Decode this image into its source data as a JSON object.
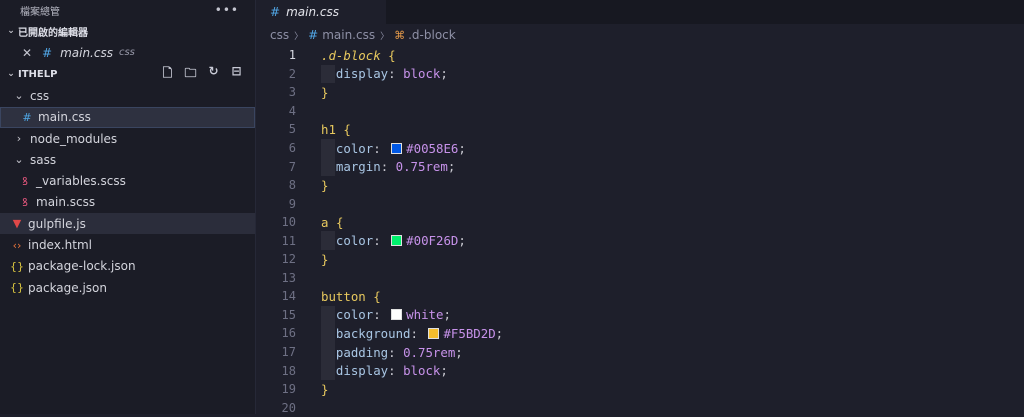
{
  "sidebar": {
    "title": "檔案總管",
    "more": "•••",
    "open_editors": {
      "header": "已開啟的編輯器",
      "items": [
        {
          "name": "main.css",
          "folder": "css"
        }
      ]
    },
    "project": {
      "header": "ITHELP",
      "tree": [
        {
          "label": "css",
          "kind": "folder"
        },
        {
          "label": "main.css",
          "kind": "css"
        },
        {
          "label": "node_modules",
          "kind": "folder-collapsed"
        },
        {
          "label": "sass",
          "kind": "folder"
        },
        {
          "label": "_variables.scss",
          "kind": "scss"
        },
        {
          "label": "main.scss",
          "kind": "scss"
        },
        {
          "label": "gulpfile.js",
          "kind": "gulp"
        },
        {
          "label": "index.html",
          "kind": "html"
        },
        {
          "label": "package-lock.json",
          "kind": "json"
        },
        {
          "label": "package.json",
          "kind": "json"
        }
      ]
    }
  },
  "editor": {
    "tab_label": "main.css",
    "breadcrumb": [
      "css",
      "main.css",
      ".d-block"
    ],
    "line_numbers": [
      "1",
      "2",
      "3",
      "4",
      "5",
      "6",
      "7",
      "8",
      "9",
      "10",
      "11",
      "12",
      "13",
      "14",
      "15",
      "16",
      "17",
      "18",
      "19",
      "20"
    ],
    "code": {
      "l1_sel": ".d-block",
      "l1_brace": "{",
      "l2_prop": "display",
      "l2_val": "block",
      "l3_brace": "}",
      "l5_sel": "h1",
      "l5_brace": "{",
      "l6_prop": "color",
      "l6_val": "#0058E6",
      "l7_prop": "margin",
      "l7_val": "0.75rem",
      "l8_brace": "}",
      "l10_sel": "a",
      "l10_brace": "{",
      "l11_prop": "color",
      "l11_val": "#00F26D",
      "l12_brace": "}",
      "l14_sel": "button",
      "l14_brace": "{",
      "l15_prop": "color",
      "l15_val": "white",
      "l16_prop": "background",
      "l16_val": "#F5BD2D",
      "l17_prop": "padding",
      "l17_val": "0.75rem",
      "l18_prop": "display",
      "l18_val": "block",
      "l19_brace": "}"
    },
    "swatches": {
      "l6": "#0058E6",
      "l11": "#00F26D",
      "l15": "#FFFFFF",
      "l16": "#F5BD2D"
    }
  }
}
